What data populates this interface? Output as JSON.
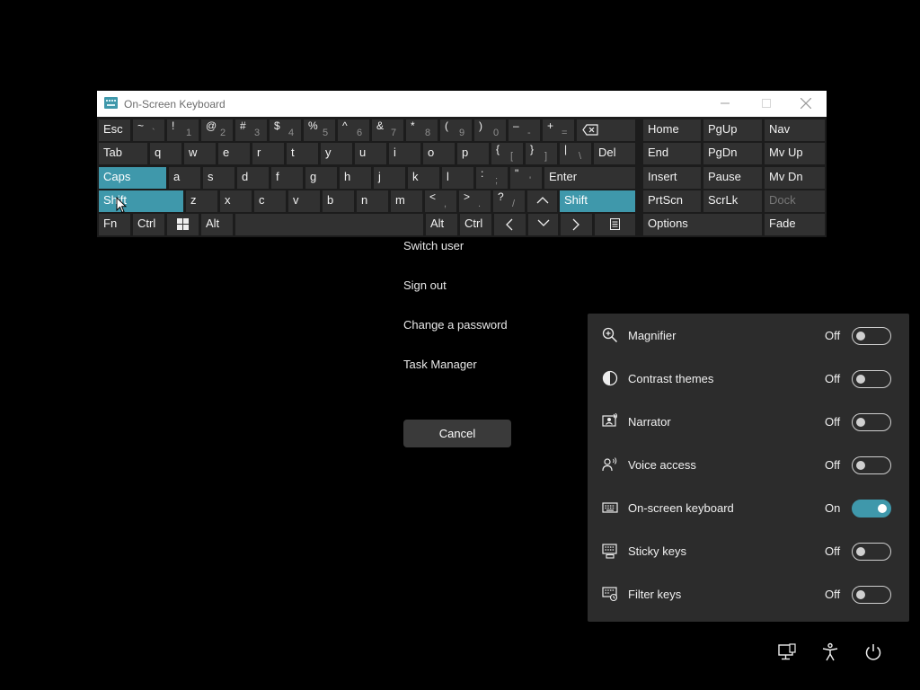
{
  "osk": {
    "title": "On-Screen Keyboard",
    "keys": {
      "esc": "Esc",
      "tilde": "~",
      "backtick": "`",
      "excl": "!",
      "one": "1",
      "at": "@",
      "two": "2",
      "hash": "#",
      "three": "3",
      "dollar": "$",
      "four": "4",
      "percent": "%",
      "five": "5",
      "caret": "^",
      "six": "6",
      "amp": "&",
      "seven": "7",
      "star": "*",
      "eight": "8",
      "lparen": "(",
      "nine": "9",
      "rparen": ")",
      "zero": "0",
      "minus_up": "–",
      "minus": "-",
      "plus": "+",
      "equals": "=",
      "tab": "Tab",
      "q": "q",
      "w": "w",
      "e": "e",
      "r": "r",
      "t": "t",
      "y": "y",
      "u": "u",
      "i": "i",
      "o": "o",
      "p": "p",
      "lbrace": "{",
      "lbracket": "[",
      "rbrace": "}",
      "rbracket": "]",
      "pipe": "|",
      "backslash": "\\",
      "del": "Del",
      "caps": "Caps",
      "a": "a",
      "s": "s",
      "d": "d",
      "f": "f",
      "g": "g",
      "h": "h",
      "j": "j",
      "k": "k",
      "l": "l",
      "colon": ":",
      "semicolon": ";",
      "quote": "\"",
      "apostrophe": "'",
      "enter": "Enter",
      "shift": "Shift",
      "z": "z",
      "x": "x",
      "c": "c",
      "v": "v",
      "b": "b",
      "n": "n",
      "m": "m",
      "lt": "<",
      "comma": ",",
      "gt": ">",
      "period": ".",
      "question": "?",
      "slash": "/",
      "shift_right": "Shift",
      "fn": "Fn",
      "ctrl": "Ctrl",
      "alt": "Alt",
      "alt_right": "Alt",
      "ctrl_right": "Ctrl",
      "home": "Home",
      "pgup": "PgUp",
      "nav": "Nav",
      "end": "End",
      "pgdn": "PgDn",
      "mvup": "Mv Up",
      "insert": "Insert",
      "pause": "Pause",
      "mvdn": "Mv Dn",
      "prtscn": "PrtScn",
      "scrlk": "ScrLk",
      "dock": "Dock",
      "options": "Options",
      "fade": "Fade"
    }
  },
  "signin_menu": {
    "switch_user": "Switch user",
    "sign_out": "Sign out",
    "change_password": "Change a password",
    "task_manager": "Task Manager",
    "cancel": "Cancel"
  },
  "accessibility": {
    "items": [
      {
        "label": "Magnifier",
        "state": "Off",
        "on": false,
        "icon": "magnifier-icon"
      },
      {
        "label": "Contrast themes",
        "state": "Off",
        "on": false,
        "icon": "contrast-icon"
      },
      {
        "label": "Narrator",
        "state": "Off",
        "on": false,
        "icon": "narrator-icon"
      },
      {
        "label": "Voice access",
        "state": "Off",
        "on": false,
        "icon": "voice-access-icon"
      },
      {
        "label": "On-screen keyboard",
        "state": "On",
        "on": true,
        "icon": "keyboard-icon"
      },
      {
        "label": "Sticky keys",
        "state": "Off",
        "on": false,
        "icon": "sticky-keys-icon"
      },
      {
        "label": "Filter keys",
        "state": "Off",
        "on": false,
        "icon": "filter-keys-icon"
      }
    ]
  },
  "bottom_bar": [
    "network-icon",
    "accessibility-icon",
    "power-icon"
  ],
  "colors": {
    "accent": "#3f98ab",
    "background": "#000000",
    "panel": "#2c2c2c",
    "key": "#313131"
  }
}
